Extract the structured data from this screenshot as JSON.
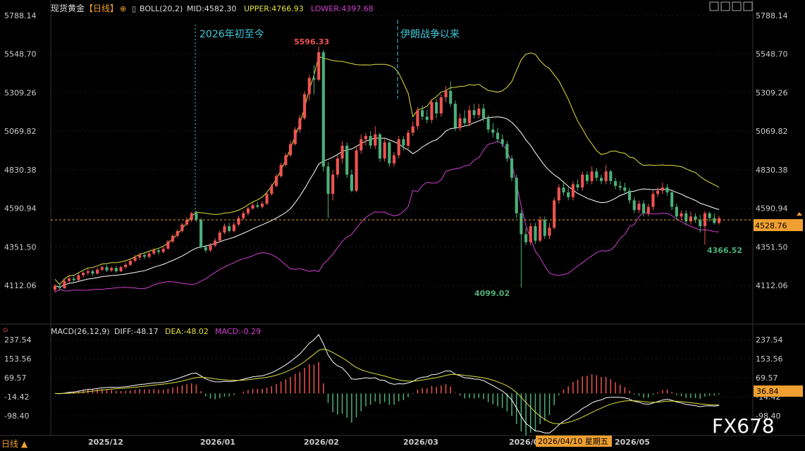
{
  "header": {
    "symbol": "现货黄金",
    "period": "【日线】",
    "indicator": "BOLL(20,2)",
    "mid": "MID:4582.30",
    "upper": "UPPER:4766.93",
    "lower": "LOWER:4397.68"
  },
  "macd_header": {
    "name": "MACD(26,12,9)",
    "diff": "DIFF:-48.17",
    "dea": "DEA:-48.02",
    "macd": "MACD:-0.29"
  },
  "annotations": {
    "ytd": "2026年初至今",
    "iran_war": "伊朗战争以来",
    "high": "5596.33",
    "low": "4099.02",
    "recent_low": "4366.52"
  },
  "price_label": "4528.76",
  "macd_label": "36.84",
  "crosshair_date": "2026/04/10 星期五",
  "footer": {
    "period": "日线 ▲"
  },
  "watermark": "FX678",
  "colors": {
    "up": "#ef5350",
    "down": "#4caf78",
    "upper": "#e0e040",
    "mid": "#ffffff",
    "lower": "#d040d0",
    "diff": "#ffffff",
    "dea": "#e0e040",
    "annotation": "#40c8d8",
    "price_line": "#f0a030"
  },
  "chart_data": {
    "type": "candlestick",
    "price_axis_ticks": [
      "5788.14",
      "5548.70",
      "5309.26",
      "5069.82",
      "4830.38",
      "4590.94",
      "4351.50",
      "4112.06"
    ],
    "macd_axis_ticks": [
      "237.54",
      "153.56",
      "69.57",
      "-14.42",
      "-98.40"
    ],
    "x_ticks": [
      "2025/12",
      "2026/01",
      "2026/02",
      "2026/03",
      "2026/04",
      "2026/05"
    ],
    "x_tick_labels_shown": [
      "2025/12",
      "2026/01",
      "2026/02",
      "2026/03",
      "2026/0",
      "2026/05"
    ],
    "candles": [
      [
        4085,
        4110,
        4070,
        4120
      ],
      [
        4108,
        4095,
        4080,
        4125
      ],
      [
        4095,
        4140,
        4090,
        4150
      ],
      [
        4140,
        4155,
        4125,
        4170
      ],
      [
        4155,
        4145,
        4130,
        4168
      ],
      [
        4145,
        4175,
        4140,
        4185
      ],
      [
        4175,
        4190,
        4160,
        4200
      ],
      [
        4190,
        4200,
        4175,
        4215
      ],
      [
        4200,
        4185,
        4170,
        4210
      ],
      [
        4185,
        4210,
        4180,
        4222
      ],
      [
        4210,
        4225,
        4200,
        4235
      ],
      [
        4225,
        4205,
        4195,
        4240
      ],
      [
        4205,
        4220,
        4195,
        4230
      ],
      [
        4220,
        4200,
        4190,
        4232
      ],
      [
        4200,
        4225,
        4195,
        4235
      ],
      [
        4225,
        4240,
        4215,
        4255
      ],
      [
        4240,
        4265,
        4230,
        4275
      ],
      [
        4265,
        4285,
        4255,
        4300
      ],
      [
        4285,
        4300,
        4270,
        4315
      ],
      [
        4300,
        4290,
        4275,
        4320
      ],
      [
        4290,
        4310,
        4280,
        4320
      ],
      [
        4310,
        4330,
        4300,
        4345
      ],
      [
        4330,
        4320,
        4305,
        4345
      ],
      [
        4320,
        4340,
        4310,
        4355
      ],
      [
        4340,
        4385,
        4335,
        4395
      ],
      [
        4385,
        4420,
        4375,
        4430
      ],
      [
        4420,
        4450,
        4410,
        4460
      ],
      [
        4450,
        4490,
        4440,
        4500
      ],
      [
        4490,
        4520,
        4480,
        4535
      ],
      [
        4520,
        4560,
        4505,
        4570
      ],
      [
        4560,
        4520,
        4505,
        4575
      ],
      [
        4520,
        4350,
        4340,
        4530
      ],
      [
        4350,
        4330,
        4315,
        4365
      ],
      [
        4330,
        4360,
        4320,
        4375
      ],
      [
        4360,
        4390,
        4350,
        4405
      ],
      [
        4390,
        4440,
        4380,
        4455
      ],
      [
        4440,
        4480,
        4430,
        4495
      ],
      [
        4480,
        4450,
        4440,
        4500
      ],
      [
        4450,
        4490,
        4440,
        4505
      ],
      [
        4490,
        4530,
        4480,
        4545
      ],
      [
        4530,
        4560,
        4520,
        4575
      ],
      [
        4560,
        4590,
        4545,
        4600
      ],
      [
        4590,
        4610,
        4580,
        4625
      ],
      [
        4610,
        4600,
        4590,
        4630
      ],
      [
        4600,
        4620,
        4590,
        4635
      ],
      [
        4620,
        4680,
        4610,
        4690
      ],
      [
        4680,
        4730,
        4670,
        4745
      ],
      [
        4730,
        4790,
        4720,
        4805
      ],
      [
        4790,
        4860,
        4780,
        4875
      ],
      [
        4860,
        4920,
        4850,
        4935
      ],
      [
        4920,
        4990,
        4910,
        5010
      ],
      [
        4990,
        5080,
        4980,
        5095
      ],
      [
        5080,
        5150,
        5060,
        5170
      ],
      [
        5150,
        5300,
        5140,
        5320
      ],
      [
        5300,
        5400,
        5260,
        5420
      ],
      [
        5400,
        5390,
        5300,
        5480
      ],
      [
        5390,
        5560,
        5380,
        5596
      ],
      [
        5560,
        4850,
        4820,
        5575
      ],
      [
        4850,
        4680,
        4530,
        4880
      ],
      [
        4680,
        4800,
        4640,
        4830
      ],
      [
        4800,
        4900,
        4780,
        4920
      ],
      [
        4900,
        4980,
        4870,
        5010
      ],
      [
        4980,
        4800,
        4780,
        5000
      ],
      [
        4800,
        4700,
        4690,
        4830
      ],
      [
        4700,
        4950,
        4690,
        4980
      ],
      [
        4950,
        5020,
        4930,
        5050
      ],
      [
        5020,
        5040,
        4980,
        5060
      ],
      [
        5040,
        4980,
        4960,
        5070
      ],
      [
        4980,
        5050,
        4960,
        5100
      ],
      [
        5050,
        4900,
        4880,
        5060
      ],
      [
        4900,
        5000,
        4880,
        5020
      ],
      [
        5000,
        4870,
        4850,
        5010
      ],
      [
        4870,
        4920,
        4850,
        4940
      ],
      [
        4920,
        5020,
        4900,
        5040
      ],
      [
        5020,
        4980,
        4950,
        5040
      ],
      [
        4980,
        5060,
        4960,
        5080
      ],
      [
        5060,
        5100,
        5040,
        5130
      ],
      [
        5100,
        5200,
        5080,
        5220
      ],
      [
        5200,
        5160,
        5140,
        5230
      ],
      [
        5160,
        5140,
        5120,
        5200
      ],
      [
        5140,
        5250,
        5120,
        5270
      ],
      [
        5250,
        5180,
        5150,
        5270
      ],
      [
        5180,
        5280,
        5160,
        5300
      ],
      [
        5280,
        5320,
        5250,
        5350
      ],
      [
        5320,
        5240,
        5220,
        5380
      ],
      [
        5240,
        5090,
        5070,
        5260
      ],
      [
        5090,
        5150,
        5070,
        5180
      ],
      [
        5150,
        5120,
        5100,
        5200
      ],
      [
        5120,
        5200,
        5100,
        5230
      ],
      [
        5200,
        5170,
        5150,
        5240
      ],
      [
        5170,
        5210,
        5150,
        5240
      ],
      [
        5210,
        5150,
        5130,
        5240
      ],
      [
        5150,
        5080,
        5060,
        5170
      ],
      [
        5080,
        5060,
        5030,
        5120
      ],
      [
        5060,
        5020,
        5000,
        5090
      ],
      [
        5020,
        4990,
        4970,
        5050
      ],
      [
        4990,
        4900,
        4880,
        5010
      ],
      [
        4900,
        4780,
        4760,
        4920
      ],
      [
        4780,
        4560,
        4530,
        4800
      ],
      [
        4560,
        4430,
        4099,
        4580
      ],
      [
        4430,
        4380,
        4360,
        4470
      ],
      [
        4380,
        4480,
        4360,
        4500
      ],
      [
        4480,
        4390,
        4370,
        4500
      ],
      [
        4390,
        4520,
        4380,
        4540
      ],
      [
        4520,
        4420,
        4400,
        4540
      ],
      [
        4420,
        4470,
        4400,
        4500
      ],
      [
        4470,
        4640,
        4460,
        4660
      ],
      [
        4640,
        4720,
        4620,
        4740
      ],
      [
        4720,
        4690,
        4670,
        4760
      ],
      [
        4690,
        4660,
        4640,
        4720
      ],
      [
        4660,
        4740,
        4640,
        4760
      ],
      [
        4740,
        4720,
        4700,
        4770
      ],
      [
        4720,
        4800,
        4700,
        4820
      ],
      [
        4800,
        4760,
        4740,
        4820
      ],
      [
        4760,
        4820,
        4740,
        4850
      ],
      [
        4820,
        4780,
        4760,
        4840
      ],
      [
        4780,
        4760,
        4740,
        4800
      ],
      [
        4760,
        4820,
        4740,
        4860
      ],
      [
        4820,
        4760,
        4740,
        4830
      ],
      [
        4760,
        4730,
        4710,
        4780
      ],
      [
        4730,
        4720,
        4700,
        4760
      ],
      [
        4720,
        4700,
        4680,
        4750
      ],
      [
        4700,
        4640,
        4620,
        4720
      ],
      [
        4640,
        4580,
        4560,
        4660
      ],
      [
        4580,
        4620,
        4560,
        4640
      ],
      [
        4620,
        4560,
        4540,
        4640
      ],
      [
        4560,
        4600,
        4540,
        4620
      ],
      [
        4600,
        4680,
        4580,
        4700
      ],
      [
        4680,
        4700,
        4660,
        4720
      ],
      [
        4700,
        4720,
        4680,
        4750
      ],
      [
        4720,
        4690,
        4670,
        4740
      ],
      [
        4690,
        4600,
        4580,
        4700
      ],
      [
        4600,
        4540,
        4520,
        4620
      ],
      [
        4540,
        4560,
        4520,
        4580
      ],
      [
        4560,
        4510,
        4490,
        4580
      ],
      [
        4510,
        4540,
        4490,
        4570
      ],
      [
        4540,
        4520,
        4500,
        4560
      ],
      [
        4520,
        4480,
        4440,
        4550
      ],
      [
        4480,
        4560,
        4366,
        4575
      ],
      [
        4560,
        4530,
        4510,
        4570
      ],
      [
        4530,
        4500,
        4490,
        4560
      ],
      [
        4500,
        4529,
        4490,
        4545
      ]
    ]
  }
}
